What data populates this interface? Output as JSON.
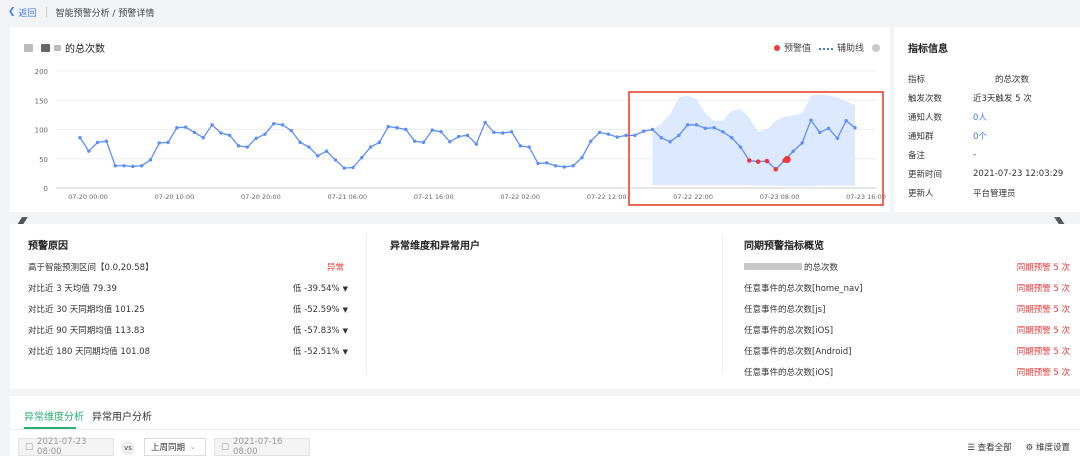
{
  "breadcrumb": {
    "back": "返回",
    "path": "智能预警分析 / 预警详情"
  },
  "chart_card": {
    "title": "的总次数",
    "legend_alert": "预警值",
    "legend_aux": "辅助线"
  },
  "chart_data": {
    "type": "line",
    "ylim": [
      0,
      200
    ],
    "y_ticks": [
      "200",
      "150",
      "100",
      "50",
      "0"
    ],
    "x_tick_labels": [
      "07-20 00:00",
      "07-20 10:00",
      "07-20 20:00",
      "07-21 06:00",
      "07-21 16:00",
      "07-22 02:00",
      "07-22 12:00",
      "07-22 22:00",
      "07-23 08:00",
      "07-23 16:00"
    ],
    "values": [
      86,
      63,
      78,
      80,
      38,
      38,
      37,
      38,
      48,
      77,
      78,
      103,
      104,
      95,
      86,
      108,
      94,
      90,
      72,
      70,
      85,
      92,
      110,
      108,
      98,
      78,
      70,
      55,
      63,
      48,
      34,
      35,
      52,
      70,
      78,
      105,
      103,
      100,
      80,
      78,
      99,
      96,
      79,
      88,
      90,
      75,
      112,
      95,
      94,
      96,
      72,
      70,
      42,
      43,
      38,
      36,
      38,
      52,
      80,
      95,
      92,
      87,
      90,
      90,
      97,
      100,
      86,
      79,
      90,
      108,
      108,
      102,
      103,
      96,
      86,
      70,
      47,
      45,
      46,
      32,
      47,
      63,
      77,
      116,
      95,
      102,
      85,
      115,
      103
    ],
    "alert_indices": [
      76,
      77,
      78,
      79,
      80
    ],
    "band_upper": [
      100,
      110,
      126,
      155,
      158,
      152,
      128,
      115,
      115,
      132,
      135,
      120,
      96,
      100,
      115,
      122,
      124,
      128,
      158,
      160,
      158,
      155,
      148,
      142
    ],
    "band_lower": [
      5,
      5,
      5,
      5,
      5,
      5,
      5,
      5,
      5,
      5,
      5,
      5,
      4,
      4,
      4,
      3,
      3,
      3,
      3,
      4,
      4,
      4,
      4,
      4
    ],
    "band_start_index": 65,
    "colors": {
      "line": "#5b8ff9",
      "alert": "#ea3a3a",
      "band": "#dde9ff",
      "highlight": "#e8442e"
    }
  },
  "info": {
    "title": "指标信息",
    "rows": [
      {
        "k": "指标",
        "v": "的总次数"
      },
      {
        "k": "触发次数",
        "v": "近3天触发 5 次"
      },
      {
        "k": "通知人数",
        "v": "0人"
      },
      {
        "k": "通知群",
        "v": "0个"
      },
      {
        "k": "备注",
        "v": "-"
      },
      {
        "k": "更新时间",
        "v": "2021-07-23 12:03:29"
      },
      {
        "k": "更新人",
        "v": "平台管理员"
      }
    ]
  },
  "reason": {
    "title": "预警原因",
    "rows": [
      {
        "label": "高于智能预测区间【0.0,20.58】",
        "value": "异常"
      },
      {
        "label": "对比近 3 天均值 79.39",
        "value": "低 -39.54%"
      },
      {
        "label": "对比近 30 天同期均值 101.25",
        "value": "低 -52.59%"
      },
      {
        "label": "对比近 90 天同期均值 113.83",
        "value": "低 -57.83%"
      },
      {
        "label": "对比近 180 天同期均值 101.08",
        "value": "低 -52.51%"
      }
    ]
  },
  "dims": {
    "title": "异常维度和异常用户"
  },
  "peer": {
    "title": "同期预警指标概览",
    "rows": [
      {
        "label": "的总次数",
        "value": "同期预警 5 次"
      },
      {
        "label": "任意事件的总次数[home_nav]",
        "value": "同期预警 5 次"
      },
      {
        "label": "任意事件的总次数[js]",
        "value": "同期预警 5 次"
      },
      {
        "label": "任意事件的总次数[iOS]",
        "value": "同期预警 5 次"
      },
      {
        "label": "任意事件的总次数[Android]",
        "value": "同期预警 5 次"
      },
      {
        "label": "任意事件的总次数[iOS]",
        "value": "同期预警 5 次"
      }
    ]
  },
  "tabs": {
    "items": [
      "异常维度分析",
      "异常用户分析"
    ],
    "date_a": "2021-07-23 08:00",
    "vs": "vs",
    "compare": "上周同期",
    "date_b": "2021-07-16 08:00",
    "view_all": "查看全部",
    "dim_settings": "维度设置"
  }
}
